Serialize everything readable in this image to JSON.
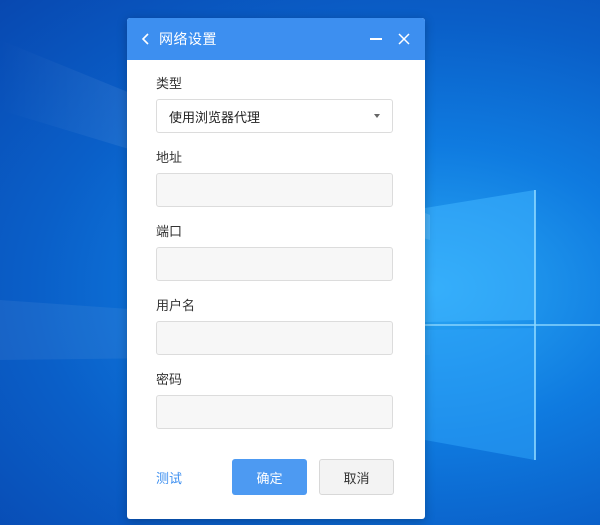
{
  "dialog": {
    "title": "网络设置",
    "back_icon": "chevron-left-icon",
    "minimize_icon": "minimize-icon",
    "close_icon": "close-icon"
  },
  "form": {
    "type": {
      "label": "类型",
      "selected": "使用浏览器代理"
    },
    "address": {
      "label": "地址",
      "value": ""
    },
    "port": {
      "label": "端口",
      "value": ""
    },
    "username": {
      "label": "用户名",
      "value": ""
    },
    "password": {
      "label": "密码",
      "value": ""
    }
  },
  "footer": {
    "test_label": "测试",
    "ok_label": "确定",
    "cancel_label": "取消"
  },
  "colors": {
    "accent": "#3d8ff0",
    "desktop": "#0f7be0"
  }
}
